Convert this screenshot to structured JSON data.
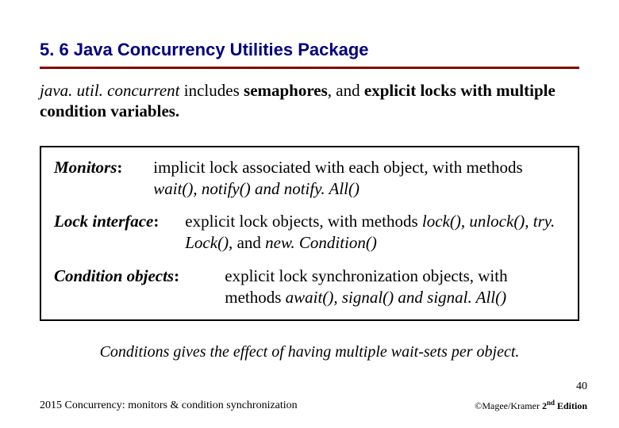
{
  "title": "5. 6  Java Concurrency Utilities Package",
  "intro": {
    "pkg": "java. util. concurrent",
    "rest1": " includes ",
    "b1": "semaphores",
    "rest2": ", and ",
    "b2": "explicit locks with multiple condition variables."
  },
  "box": {
    "monitors_label": "Monitors",
    "monitors_body_a": "implicit lock associated with each object, with methods ",
    "monitors_methods": "wait(), notify() and notify. All()",
    "lock_label": "Lock interface",
    "lock_body_a": "explicit lock objects, with methods ",
    "lock_methods": "lock(), unlock(), try. Lock(), ",
    "lock_and": "and ",
    "lock_method_last": "new. Condition()",
    "cond_label": "Condition objects",
    "cond_body_a": "explicit lock synchronization objects, with methods ",
    "cond_methods": "await(), signal() and signal. All()"
  },
  "note": "Conditions gives the effect of having multiple wait-sets per object.",
  "page_number": "40",
  "footer_left": "2015  Concurrency: monitors & condition synchronization",
  "footer_right_a": "©Magee/Kramer ",
  "footer_right_b": "2",
  "footer_right_c": "nd",
  "footer_right_d": " Edition"
}
